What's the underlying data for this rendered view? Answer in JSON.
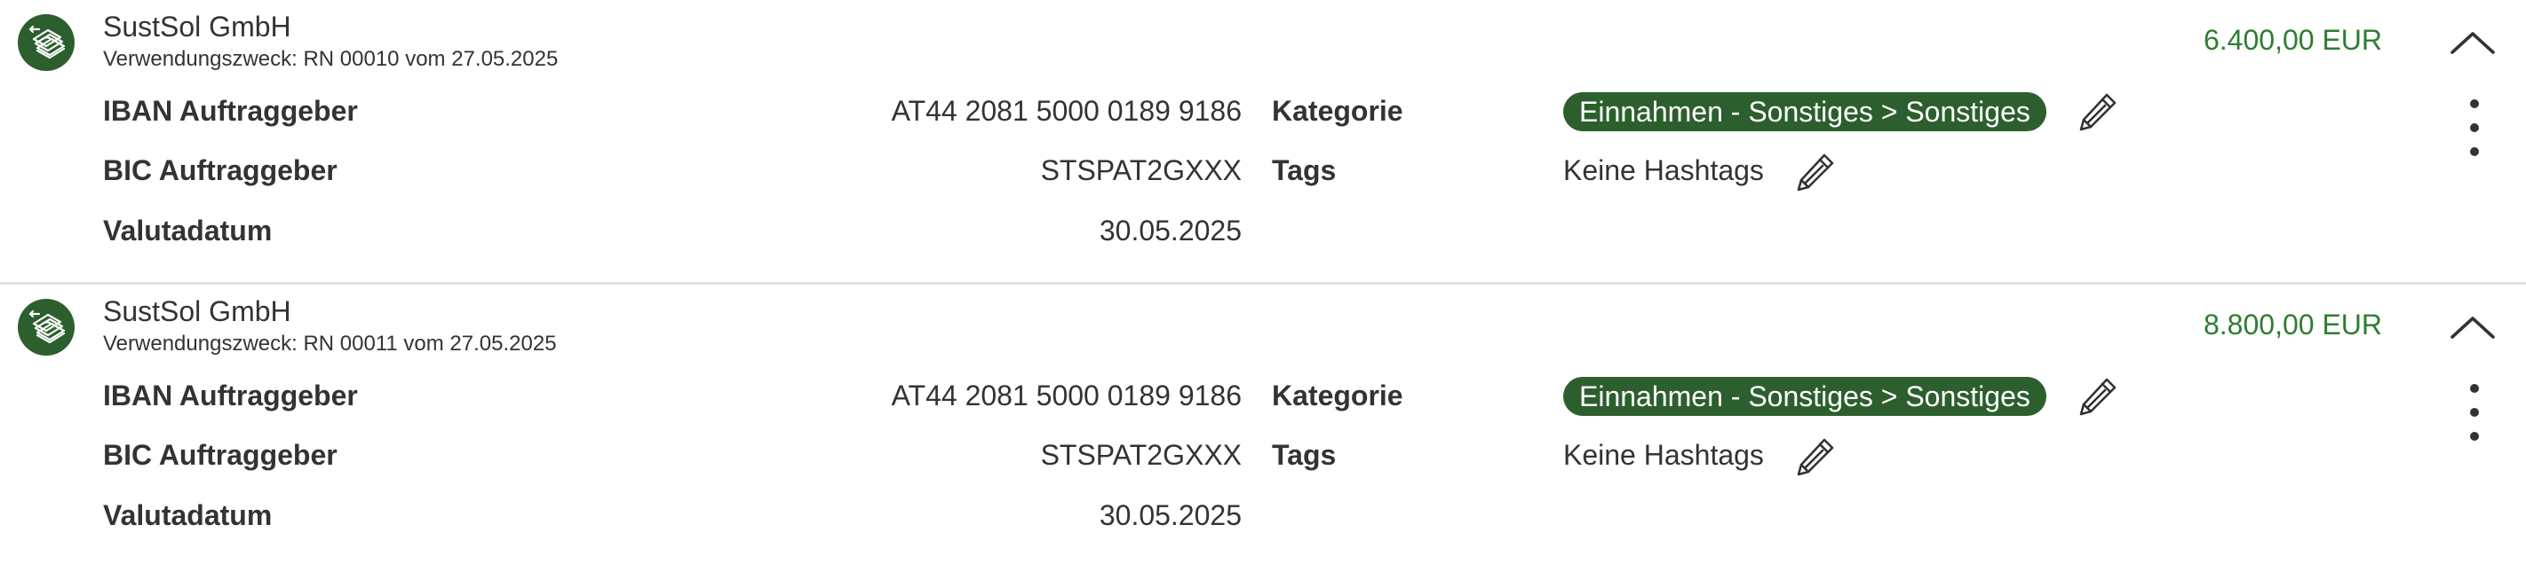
{
  "transactions": [
    {
      "payer": "SustSol GmbH",
      "purpose": "Verwendungszweck: RN 00010 vom 27.05.2025",
      "amount": "6.400,00 EUR",
      "iban_label": "IBAN Auftraggeber",
      "iban_value": "AT44 2081 5000 0189 9186",
      "bic_label": "BIC Auftraggeber",
      "bic_value": "STSPAT2GXXX",
      "value_date_label": "Valutadatum",
      "value_date": "30.05.2025",
      "category_label": "Kategorie",
      "category": "Einnahmen - Sonstiges > Sonstiges",
      "tags_label": "Tags",
      "tags": "Keine Hashtags"
    },
    {
      "payer": "SustSol GmbH",
      "purpose": "Verwendungszweck: RN 00011 vom 27.05.2025",
      "amount": "8.800,00 EUR",
      "iban_label": "IBAN Auftraggeber",
      "iban_value": "AT44 2081 5000 0189 9186",
      "bic_label": "BIC Auftraggeber",
      "bic_value": "STSPAT2GXXX",
      "value_date_label": "Valutadatum",
      "value_date": "30.05.2025",
      "category_label": "Kategorie",
      "category": "Einnahmen - Sonstiges > Sonstiges",
      "tags_label": "Tags",
      "tags": "Keine Hashtags"
    }
  ],
  "icons": {
    "avatar": "incoming-money-icon",
    "collapse": "chevron-up-icon",
    "menu": "more-vertical-icon",
    "edit": "pencil-icon"
  },
  "colors": {
    "brand_green": "#2c5f2d",
    "amount_green": "#2e7d32",
    "text": "#333333",
    "divider": "#e2e2e2"
  }
}
